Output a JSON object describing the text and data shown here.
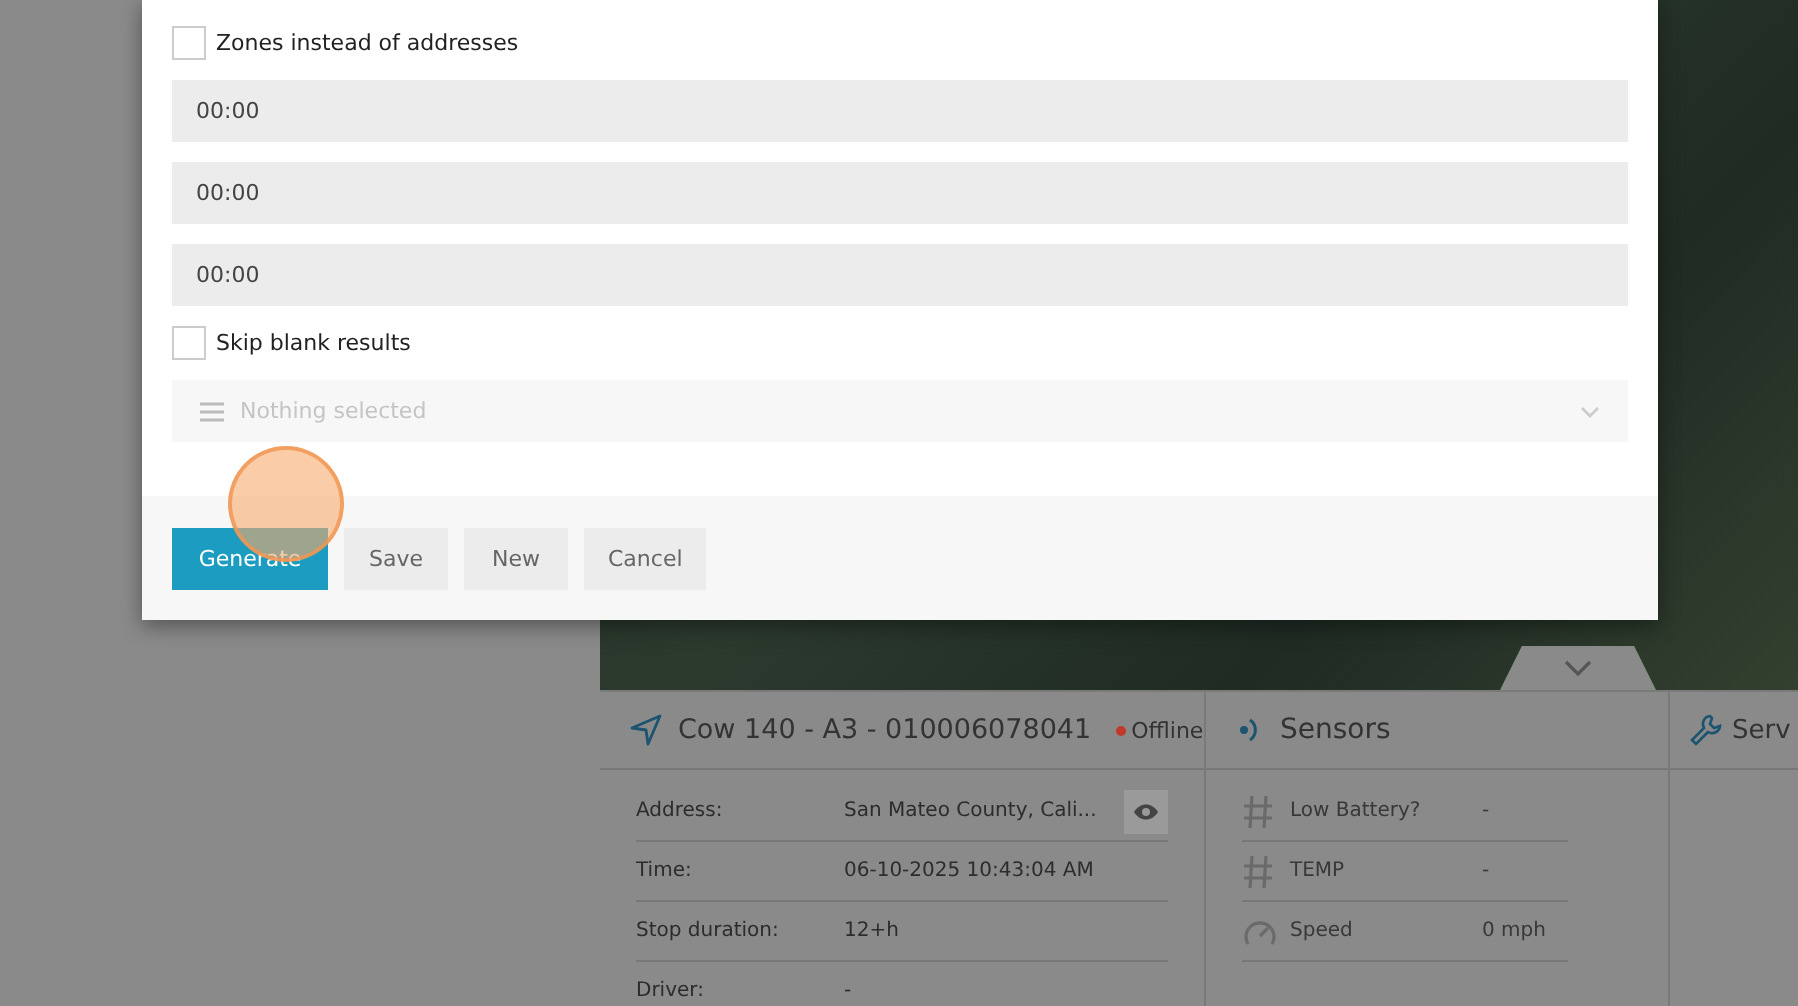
{
  "dialog": {
    "checkboxes_top": [
      {
        "label": "Zones instead of addresses",
        "checked": false
      }
    ],
    "time_fields": [
      {
        "value": "00:00"
      },
      {
        "value": "00:00"
      },
      {
        "value": "00:00"
      }
    ],
    "skip_checkbox": {
      "label": "Skip blank results",
      "checked": false
    },
    "select": {
      "placeholder": "Nothing selected"
    },
    "buttons": [
      {
        "label": "Generate",
        "kind": "primary"
      },
      {
        "label": "Save",
        "kind": "default"
      },
      {
        "label": "New",
        "kind": "default"
      },
      {
        "label": "Cancel",
        "kind": "default"
      }
    ]
  },
  "unit_panel": {
    "title": "Cow 140 - A3 - 010006078041",
    "status": "Offline",
    "rows": [
      {
        "label": "Address:",
        "value": "San Mateo County, Cali...",
        "kind": "with_view_button"
      },
      {
        "label": "Time:",
        "value": "06-10-2025 10:43:04 AM",
        "kind": "plain"
      },
      {
        "label": "Stop duration:",
        "value": "12+h",
        "kind": "plain"
      },
      {
        "label": "Driver:",
        "value": "-",
        "kind": "plain"
      }
    ]
  },
  "sensors_panel": {
    "title": "Sensors",
    "rows": [
      {
        "kind": "hash",
        "label": "Low Battery?",
        "value": "-"
      },
      {
        "kind": "hash",
        "label": "TEMP",
        "value": "-"
      },
      {
        "kind": "speed",
        "label": "Speed",
        "value": "0 mph"
      }
    ]
  },
  "service_panel": {
    "title": "Serv"
  }
}
